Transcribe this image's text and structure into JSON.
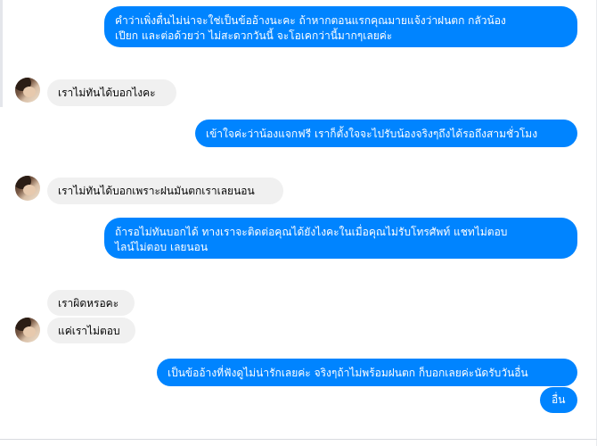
{
  "messages": [
    {
      "id": "m1",
      "dir": "out",
      "lines": [
        "คำว่าเพิ่งตื่นไม่น่าจะใช่เป็นข้ออ้างนะคะ ถ้าหากตอนแรกคุณมายแจ้งว่าฝนตก กลัวน้อง",
        "เปียก และต่อด้วยว่า ไม่สะดวกวันนี้ จะโอเคกว่านี้มากๆเลยค่ะ"
      ]
    },
    {
      "id": "m2",
      "dir": "in",
      "lines": [
        "เราไม่ทันได้บอกไงคะ"
      ]
    },
    {
      "id": "m3",
      "dir": "out",
      "lines": [
        "เข้าใจค่ะว่าน้องแจกฟรี เราก็ตั้งใจจะไปรับน้องจริงๆถึงได้รอถึงสามชั่วโมง"
      ]
    },
    {
      "id": "m4",
      "dir": "in",
      "lines": [
        "เราไม่ทันได้บอกเพราะฝนมันตกเราเลยนอน"
      ]
    },
    {
      "id": "m5",
      "dir": "out",
      "lines": [
        "ถ้ารอไม่ทันบอกได้ ทางเราจะติดต่อคุณได้ยังไงคะในเมื่อคุณไม่รับโทรศัพท์ แชทไม่ตอบ",
        "ไลน์ไม่ตอบ เลยนอน"
      ]
    },
    {
      "id": "m6",
      "dir": "in",
      "lines": [
        "เราผิดหรอคะ"
      ]
    },
    {
      "id": "m7",
      "dir": "in",
      "lines": [
        "แค่เราไม่ตอบ"
      ]
    },
    {
      "id": "m8",
      "dir": "out",
      "lines": [
        "เป็นข้ออ้างที่ฟังดูไม่น่ารักเลยค่ะ จริงๆถ้าไม่พร้อมฝนตก ก็บอกเลยค่ะนัดรับวันอื่น"
      ]
    },
    {
      "id": "m9",
      "dir": "out",
      "lines": [
        "อื่น"
      ]
    }
  ],
  "contact": {
    "avatar_icon": "profile-photo-icon"
  },
  "colors": {
    "outgoing_bubble": "#0084ff",
    "incoming_bubble": "#f0f0f0",
    "outgoing_text": "#ffffff",
    "incoming_text": "#050505"
  }
}
